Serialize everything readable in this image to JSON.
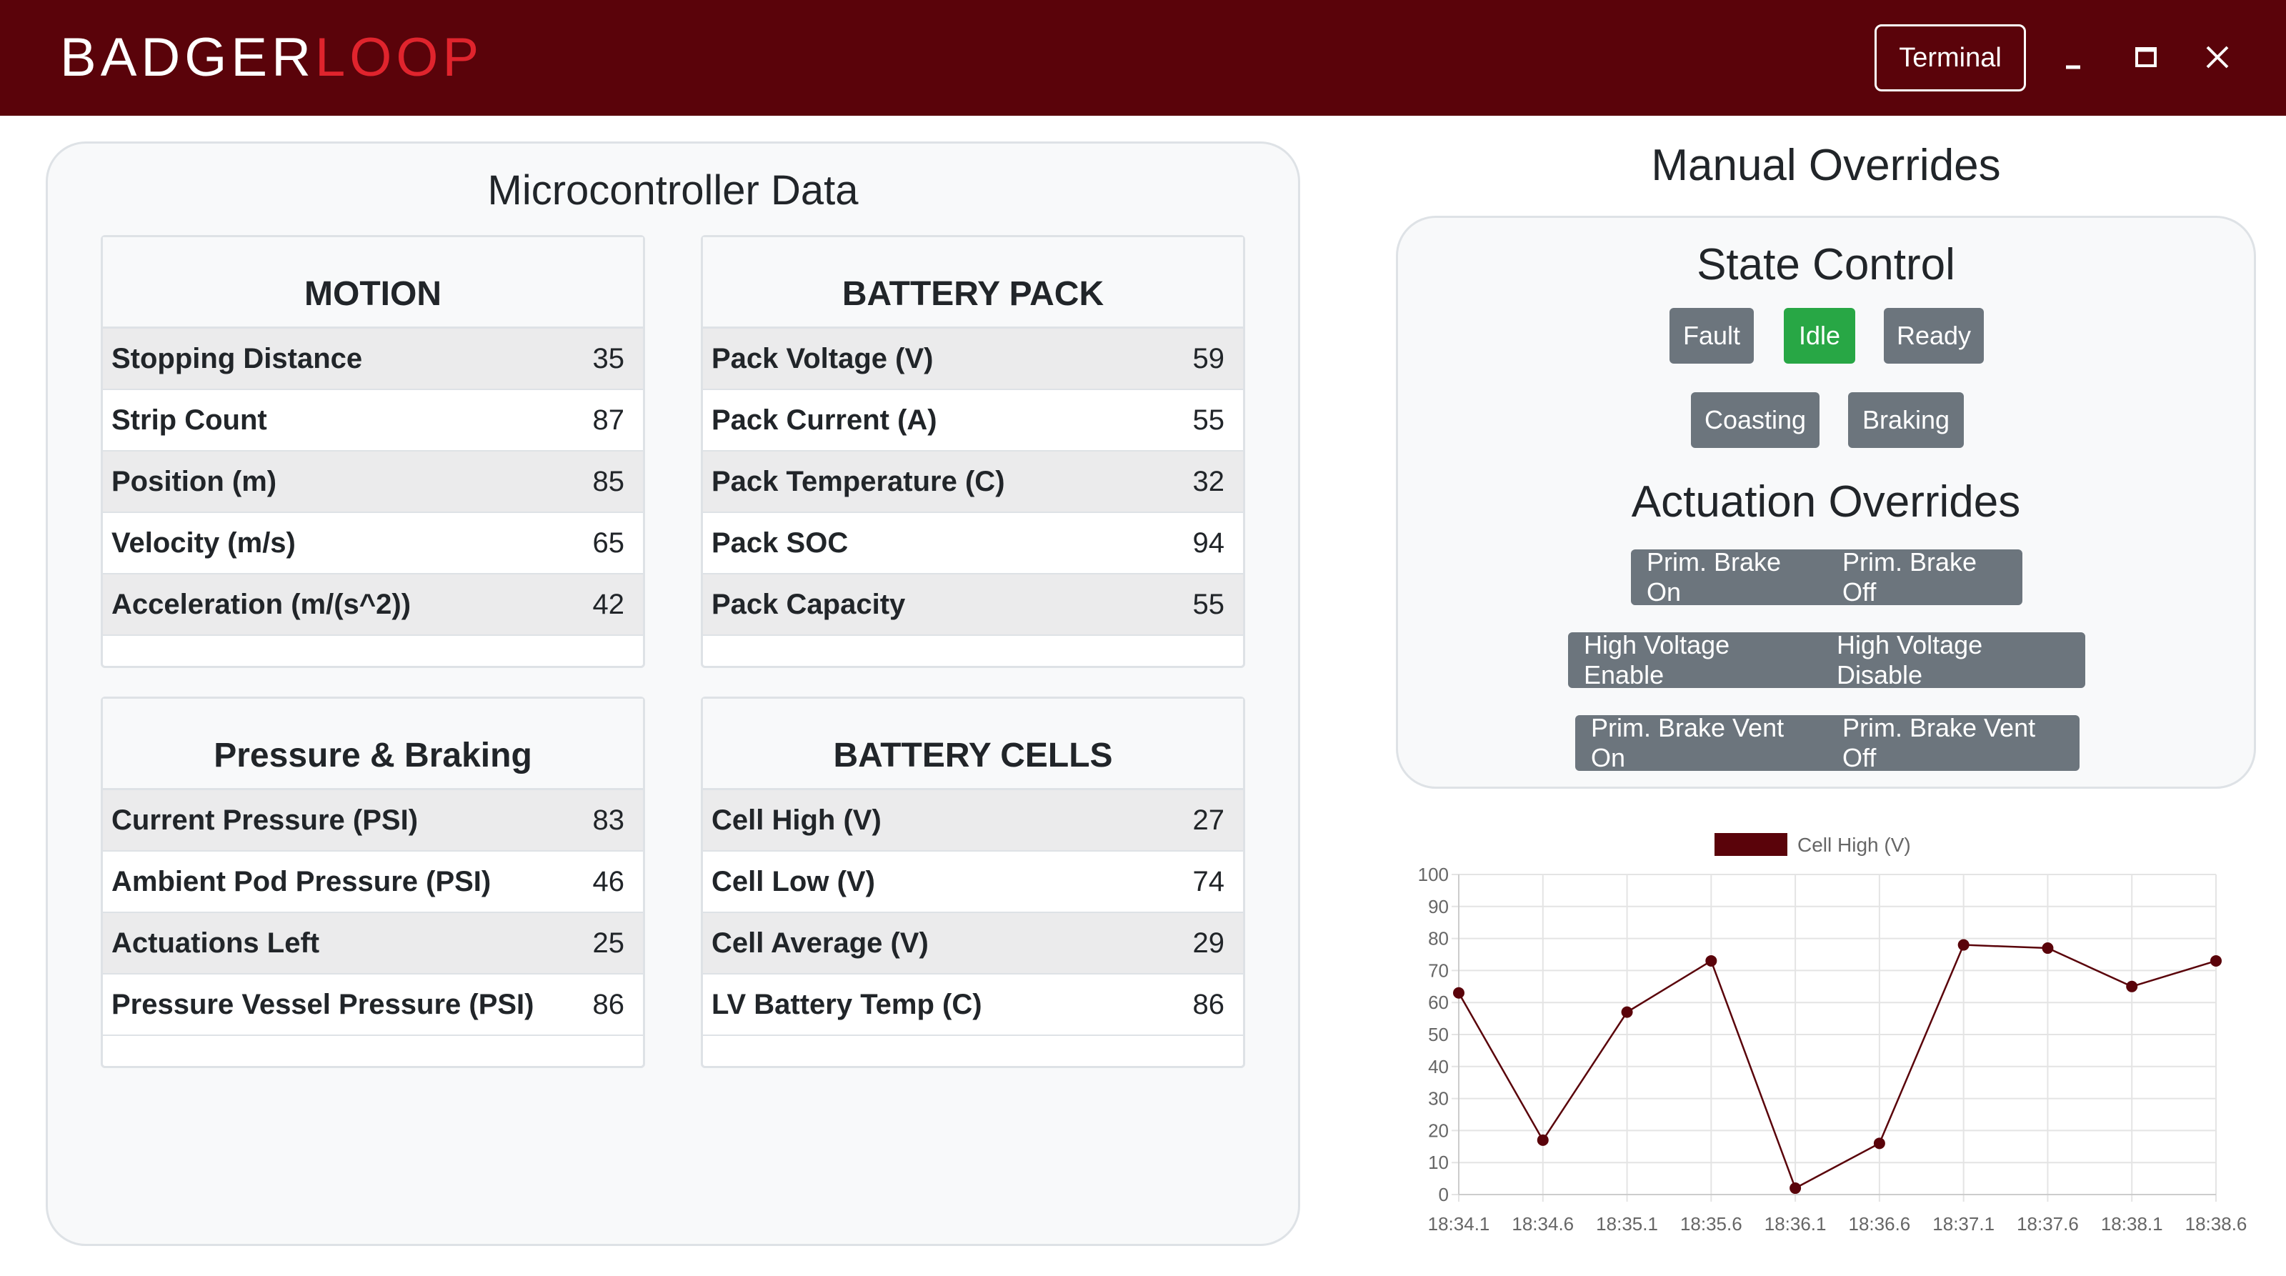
{
  "header": {
    "logo_part1": "BADGER",
    "logo_part2": "LOOP",
    "terminal_label": "Terminal"
  },
  "microcontroller": {
    "title": "Microcontroller Data",
    "motion": {
      "title": "MOTION",
      "rows": [
        {
          "label": "Stopping Distance",
          "value": "35"
        },
        {
          "label": "Strip Count",
          "value": "87"
        },
        {
          "label": "Position (m)",
          "value": "85"
        },
        {
          "label": "Velocity (m/s)",
          "value": "65"
        },
        {
          "label": "Acceleration (m/(s^2))",
          "value": "42"
        }
      ]
    },
    "battery_pack": {
      "title": "BATTERY PACK",
      "rows": [
        {
          "label": "Pack Voltage (V)",
          "value": "59"
        },
        {
          "label": "Pack Current (A)",
          "value": "55"
        },
        {
          "label": "Pack Temperature (C)",
          "value": "32"
        },
        {
          "label": "Pack SOC",
          "value": "94"
        },
        {
          "label": "Pack Capacity",
          "value": "55"
        }
      ]
    },
    "pressure_braking": {
      "title": "Pressure & Braking",
      "rows": [
        {
          "label": "Current Pressure (PSI)",
          "value": "83"
        },
        {
          "label": "Ambient Pod Pressure (PSI)",
          "value": "46"
        },
        {
          "label": "Actuations Left",
          "value": "25"
        },
        {
          "label": "Pressure Vessel Pressure (PSI)",
          "value": "86"
        }
      ]
    },
    "battery_cells": {
      "title": "BATTERY CELLS",
      "rows": [
        {
          "label": "Cell High (V)",
          "value": "27"
        },
        {
          "label": "Cell Low (V)",
          "value": "74"
        },
        {
          "label": "Cell Average (V)",
          "value": "29"
        },
        {
          "label": "LV Battery Temp (C)",
          "value": "86"
        }
      ]
    }
  },
  "overrides": {
    "title": "Manual Overrides",
    "state_control": {
      "title": "State Control",
      "buttons": [
        "Fault",
        "Idle",
        "Ready",
        "Coasting",
        "Braking"
      ],
      "active": "Idle"
    },
    "actuation": {
      "title": "Actuation Overrides",
      "groups": [
        [
          "Prim. Brake On",
          "Prim. Brake Off"
        ],
        [
          "High Voltage Enable",
          "High Voltage Disable"
        ],
        [
          "Prim. Brake Vent On",
          "Prim. Brake Vent Off"
        ]
      ]
    }
  },
  "colors": {
    "header_bg": "#5a030a",
    "logo_accent": "#e0242d",
    "button_gray": "#6c757d",
    "button_active": "#28a745",
    "chart_line": "#5a030a"
  },
  "chart_data": {
    "type": "line",
    "x": [
      "18:34.1",
      "18:34.6",
      "18:35.1",
      "18:35.6",
      "18:36.1",
      "18:36.6",
      "18:37.1",
      "18:37.6",
      "18:38.1",
      "18:38.6"
    ],
    "series": [
      {
        "name": "Cell High (V)",
        "values": [
          63,
          17,
          57,
          73,
          2,
          16,
          78,
          77,
          65,
          73
        ]
      }
    ],
    "ylim": [
      0,
      100
    ],
    "yticks": [
      "0",
      "10",
      "20",
      "30",
      "40",
      "50",
      "60",
      "70",
      "80",
      "90",
      "100"
    ],
    "grid": true,
    "legend": "top"
  }
}
